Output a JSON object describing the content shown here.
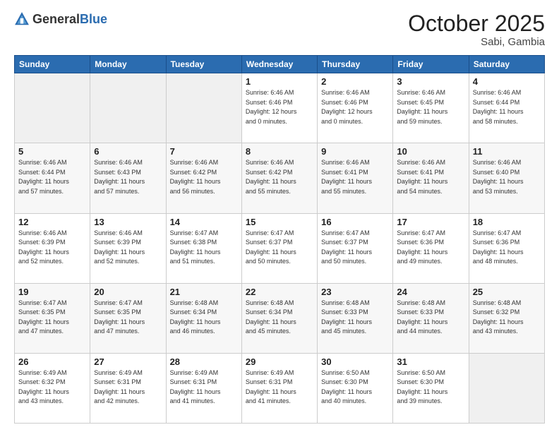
{
  "header": {
    "logo_general": "General",
    "logo_blue": "Blue",
    "month": "October 2025",
    "location": "Sabi, Gambia"
  },
  "days_of_week": [
    "Sunday",
    "Monday",
    "Tuesday",
    "Wednesday",
    "Thursday",
    "Friday",
    "Saturday"
  ],
  "weeks": [
    [
      {
        "day": "",
        "info": ""
      },
      {
        "day": "",
        "info": ""
      },
      {
        "day": "",
        "info": ""
      },
      {
        "day": "1",
        "info": "Sunrise: 6:46 AM\nSunset: 6:46 PM\nDaylight: 12 hours\nand 0 minutes."
      },
      {
        "day": "2",
        "info": "Sunrise: 6:46 AM\nSunset: 6:46 PM\nDaylight: 12 hours\nand 0 minutes."
      },
      {
        "day": "3",
        "info": "Sunrise: 6:46 AM\nSunset: 6:45 PM\nDaylight: 11 hours\nand 59 minutes."
      },
      {
        "day": "4",
        "info": "Sunrise: 6:46 AM\nSunset: 6:44 PM\nDaylight: 11 hours\nand 58 minutes."
      }
    ],
    [
      {
        "day": "5",
        "info": "Sunrise: 6:46 AM\nSunset: 6:44 PM\nDaylight: 11 hours\nand 57 minutes."
      },
      {
        "day": "6",
        "info": "Sunrise: 6:46 AM\nSunset: 6:43 PM\nDaylight: 11 hours\nand 57 minutes."
      },
      {
        "day": "7",
        "info": "Sunrise: 6:46 AM\nSunset: 6:42 PM\nDaylight: 11 hours\nand 56 minutes."
      },
      {
        "day": "8",
        "info": "Sunrise: 6:46 AM\nSunset: 6:42 PM\nDaylight: 11 hours\nand 55 minutes."
      },
      {
        "day": "9",
        "info": "Sunrise: 6:46 AM\nSunset: 6:41 PM\nDaylight: 11 hours\nand 55 minutes."
      },
      {
        "day": "10",
        "info": "Sunrise: 6:46 AM\nSunset: 6:41 PM\nDaylight: 11 hours\nand 54 minutes."
      },
      {
        "day": "11",
        "info": "Sunrise: 6:46 AM\nSunset: 6:40 PM\nDaylight: 11 hours\nand 53 minutes."
      }
    ],
    [
      {
        "day": "12",
        "info": "Sunrise: 6:46 AM\nSunset: 6:39 PM\nDaylight: 11 hours\nand 52 minutes."
      },
      {
        "day": "13",
        "info": "Sunrise: 6:46 AM\nSunset: 6:39 PM\nDaylight: 11 hours\nand 52 minutes."
      },
      {
        "day": "14",
        "info": "Sunrise: 6:47 AM\nSunset: 6:38 PM\nDaylight: 11 hours\nand 51 minutes."
      },
      {
        "day": "15",
        "info": "Sunrise: 6:47 AM\nSunset: 6:37 PM\nDaylight: 11 hours\nand 50 minutes."
      },
      {
        "day": "16",
        "info": "Sunrise: 6:47 AM\nSunset: 6:37 PM\nDaylight: 11 hours\nand 50 minutes."
      },
      {
        "day": "17",
        "info": "Sunrise: 6:47 AM\nSunset: 6:36 PM\nDaylight: 11 hours\nand 49 minutes."
      },
      {
        "day": "18",
        "info": "Sunrise: 6:47 AM\nSunset: 6:36 PM\nDaylight: 11 hours\nand 48 minutes."
      }
    ],
    [
      {
        "day": "19",
        "info": "Sunrise: 6:47 AM\nSunset: 6:35 PM\nDaylight: 11 hours\nand 47 minutes."
      },
      {
        "day": "20",
        "info": "Sunrise: 6:47 AM\nSunset: 6:35 PM\nDaylight: 11 hours\nand 47 minutes."
      },
      {
        "day": "21",
        "info": "Sunrise: 6:48 AM\nSunset: 6:34 PM\nDaylight: 11 hours\nand 46 minutes."
      },
      {
        "day": "22",
        "info": "Sunrise: 6:48 AM\nSunset: 6:34 PM\nDaylight: 11 hours\nand 45 minutes."
      },
      {
        "day": "23",
        "info": "Sunrise: 6:48 AM\nSunset: 6:33 PM\nDaylight: 11 hours\nand 45 minutes."
      },
      {
        "day": "24",
        "info": "Sunrise: 6:48 AM\nSunset: 6:33 PM\nDaylight: 11 hours\nand 44 minutes."
      },
      {
        "day": "25",
        "info": "Sunrise: 6:48 AM\nSunset: 6:32 PM\nDaylight: 11 hours\nand 43 minutes."
      }
    ],
    [
      {
        "day": "26",
        "info": "Sunrise: 6:49 AM\nSunset: 6:32 PM\nDaylight: 11 hours\nand 43 minutes."
      },
      {
        "day": "27",
        "info": "Sunrise: 6:49 AM\nSunset: 6:31 PM\nDaylight: 11 hours\nand 42 minutes."
      },
      {
        "day": "28",
        "info": "Sunrise: 6:49 AM\nSunset: 6:31 PM\nDaylight: 11 hours\nand 41 minutes."
      },
      {
        "day": "29",
        "info": "Sunrise: 6:49 AM\nSunset: 6:31 PM\nDaylight: 11 hours\nand 41 minutes."
      },
      {
        "day": "30",
        "info": "Sunrise: 6:50 AM\nSunset: 6:30 PM\nDaylight: 11 hours\nand 40 minutes."
      },
      {
        "day": "31",
        "info": "Sunrise: 6:50 AM\nSunset: 6:30 PM\nDaylight: 11 hours\nand 39 minutes."
      },
      {
        "day": "",
        "info": ""
      }
    ]
  ]
}
